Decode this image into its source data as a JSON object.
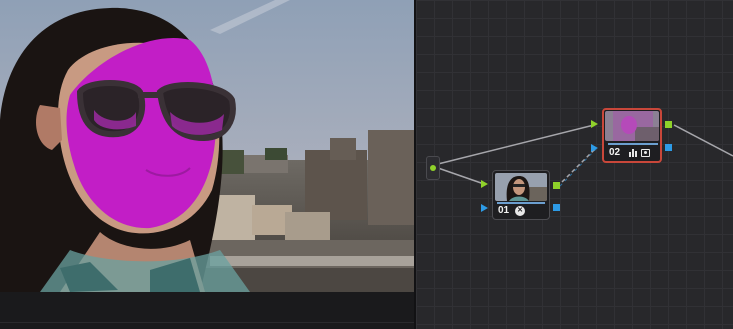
{
  "viewer": {
    "content": "photo-preview-with-face-qualifier-highlight"
  },
  "node_graph": {
    "nodes": [
      {
        "label": "01",
        "icons": [
          "fx-icon"
        ],
        "selected": false
      },
      {
        "label": "02",
        "icons": [
          "curves-icon",
          "qualifier-icon"
        ],
        "selected": true
      }
    ]
  },
  "colors": {
    "selection_border": "#c9473a",
    "rgb_port": "#8fd12a",
    "key_port": "#2d9be6",
    "highlight_magenta": "#c21ec6"
  }
}
